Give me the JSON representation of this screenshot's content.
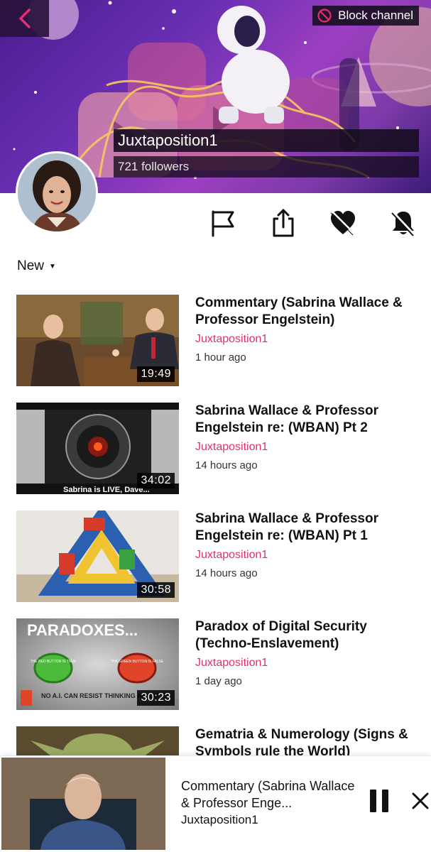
{
  "header": {
    "block_label": "Block channel",
    "channel_name": "Juxtaposition1",
    "followers": "721 followers"
  },
  "actions": [
    "flag-icon",
    "share-icon",
    "unfollow-heart-icon",
    "mute-bell-icon"
  ],
  "sort": {
    "label": "New"
  },
  "videos": [
    {
      "title": "Commentary (Sabrina Wallace & Professor Engelstein)",
      "channel": "Juxtaposition1",
      "time": "1 hour ago",
      "duration": "19:49"
    },
    {
      "title": "Sabrina Wallace & Professor Engelstein re: (WBAN) Pt 2",
      "channel": "Juxtaposition1",
      "time": "14 hours ago",
      "duration": "34:02",
      "caption": "Sabrina is LIVE, Dave..."
    },
    {
      "title": "Sabrina Wallace & Professor Engelstein re: (WBAN) Pt 1",
      "channel": "Juxtaposition1",
      "time": "14 hours ago",
      "duration": "30:58"
    },
    {
      "title": "Paradox of Digital Security (Techno-Enslavement)",
      "channel": "Juxtaposition1",
      "time": "1 day ago",
      "duration": "30:23",
      "thumb_heading": "PARADOXES...",
      "thumb_red": "THE RED BUTTON IS TRUE",
      "thumb_green": "THE GREEN BUTTON IS FALSE",
      "thumb_caption": "NO A.I. CAN RESIST THINKING ABOUT TH"
    },
    {
      "title": "Gematria & Numerology (Signs & Symbols rule the World)"
    }
  ],
  "mini_player": {
    "title": "Commentary (Sabrina Wallace & Professor Enge...",
    "channel": "Juxtaposition1"
  },
  "colors": {
    "accent": "#e0306b",
    "banner": "#6a2fb3"
  }
}
